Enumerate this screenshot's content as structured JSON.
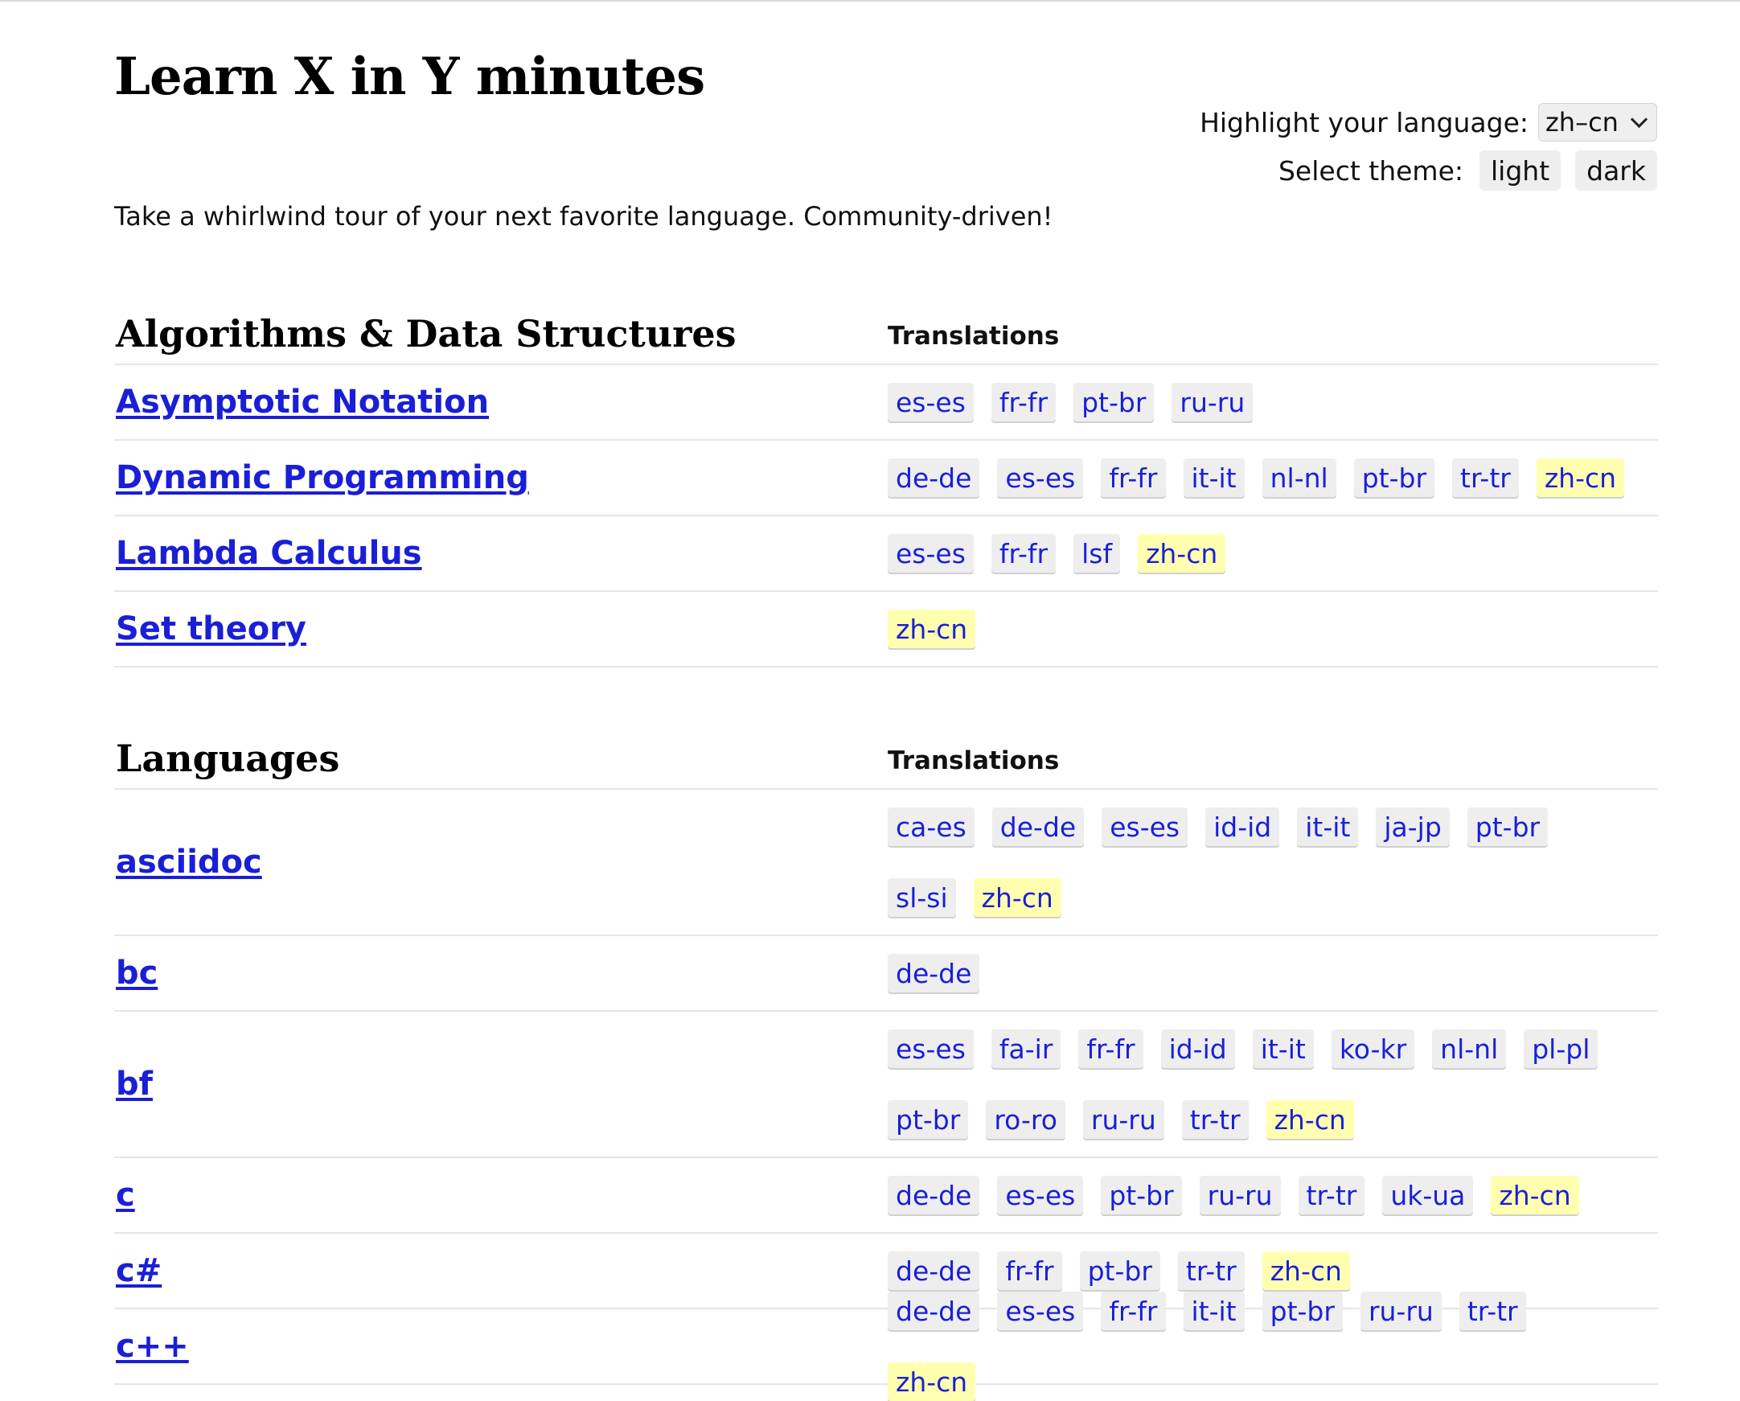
{
  "page": {
    "title": "Learn X in Y minutes",
    "tagline": "Take a whirlwind tour of your next favorite language. Community-driven!"
  },
  "controls": {
    "highlight_label": "Highlight your language:",
    "highlight_value": "zh–cn",
    "theme_label": "Select theme:",
    "theme_light": "light",
    "theme_dark": "dark"
  },
  "colors": {
    "link": "#1a1fd6",
    "chip_bg": "#eeeeee",
    "chip_highlight": "#ffffb0"
  },
  "highlight_code": "zh-cn",
  "sections": [
    {
      "title": "Algorithms & Data Structures",
      "translations_header": "Translations",
      "items": [
        {
          "name": "Asymptotic Notation",
          "translations": [
            "es-es",
            "fr-fr",
            "pt-br",
            "ru-ru"
          ]
        },
        {
          "name": "Dynamic Programming",
          "translations": [
            "de-de",
            "es-es",
            "fr-fr",
            "it-it",
            "nl-nl",
            "pt-br",
            "tr-tr",
            "zh-cn"
          ]
        },
        {
          "name": "Lambda Calculus",
          "translations": [
            "es-es",
            "fr-fr",
            "lsf",
            "zh-cn"
          ]
        },
        {
          "name": "Set theory",
          "translations": [
            "zh-cn"
          ]
        }
      ]
    },
    {
      "title": "Languages",
      "translations_header": "Translations",
      "items": [
        {
          "name": "asciidoc",
          "translations": [
            "ca-es",
            "de-de",
            "es-es",
            "id-id",
            "it-it",
            "ja-jp",
            "pt-br",
            "sl-si",
            "zh-cn"
          ]
        },
        {
          "name": "bc",
          "translations": [
            "de-de"
          ]
        },
        {
          "name": "bf",
          "translations": [
            "es-es",
            "fa-ir",
            "fr-fr",
            "id-id",
            "it-it",
            "ko-kr",
            "nl-nl",
            "pl-pl",
            "pt-br",
            "ro-ro",
            "ru-ru",
            "tr-tr",
            "zh-cn"
          ]
        },
        {
          "name": "c",
          "translations": [
            "de-de",
            "es-es",
            "pt-br",
            "ru-ru",
            "tr-tr",
            "uk-ua",
            "zh-cn"
          ]
        },
        {
          "name": "c#",
          "translations": [
            "de-de",
            "fr-fr",
            "pt-br",
            "tr-tr",
            "zh-cn"
          ]
        },
        {
          "name": "c++",
          "translations": [
            "de-de",
            "es-es",
            "fr-fr",
            "it-it",
            "pt-br",
            "ru-ru",
            "tr-tr",
            "zh-cn"
          ]
        }
      ]
    }
  ]
}
